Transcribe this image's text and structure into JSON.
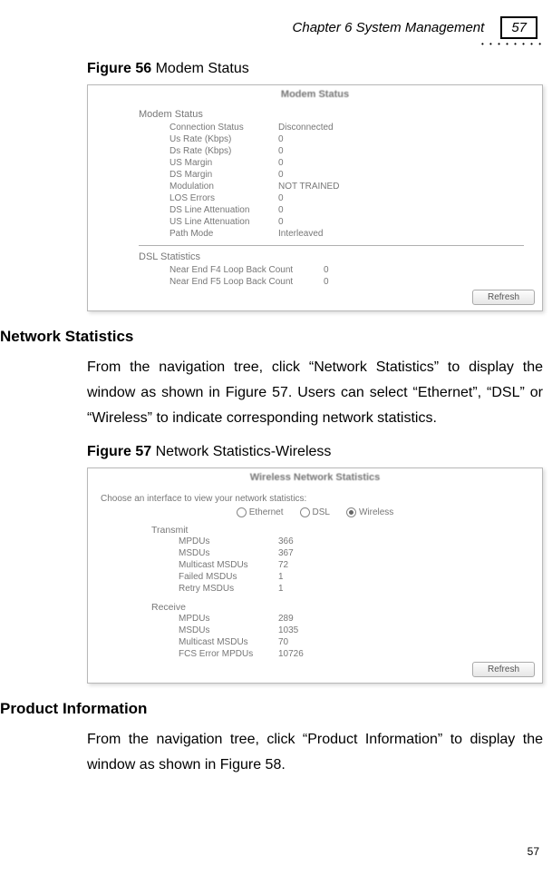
{
  "header": {
    "chapter": "Chapter 6 System Management",
    "page_box": "57"
  },
  "fig56": {
    "caption_bold": "Figure 56",
    "caption_rest": " Modem Status",
    "panel_title": "Modem Status",
    "section1": "Modem Status",
    "rows1": [
      {
        "k": "Connection Status",
        "v": "Disconnected"
      },
      {
        "k": "Us Rate (Kbps)",
        "v": "0"
      },
      {
        "k": "Ds Rate (Kbps)",
        "v": "0"
      },
      {
        "k": "US Margin",
        "v": "0"
      },
      {
        "k": "DS Margin",
        "v": "0"
      },
      {
        "k": "Modulation",
        "v": "NOT TRAINED"
      },
      {
        "k": "LOS Errors",
        "v": "0"
      },
      {
        "k": "DS Line Attenuation",
        "v": "0"
      },
      {
        "k": "US Line Attenuation",
        "v": "0"
      },
      {
        "k": "Path Mode",
        "v": "Interleaved"
      }
    ],
    "section2": "DSL Statistics",
    "rows2": [
      {
        "k": "Near End F4 Loop Back Count",
        "v": "0"
      },
      {
        "k": "Near End F5 Loop Back Count",
        "v": "0"
      }
    ],
    "refresh": "Refresh"
  },
  "network_stats": {
    "heading": "Network Statistics",
    "para": "From the navigation tree, click “Network Statistics” to display the window as shown in Figure 57. Users can select “Ethernet”, “DSL” or “Wireless” to indicate corresponding network statistics."
  },
  "fig57": {
    "caption_bold": "Figure 57",
    "caption_rest": " Network Statistics-Wireless",
    "panel_title": "Wireless Network Statistics",
    "choose": "Choose an interface to view your network statistics:",
    "radios": [
      {
        "label": "Ethernet",
        "checked": false
      },
      {
        "label": "DSL",
        "checked": false
      },
      {
        "label": "Wireless",
        "checked": true
      }
    ],
    "transmit_label": "Transmit",
    "transmit_rows": [
      {
        "k": "MPDUs",
        "v": "366"
      },
      {
        "k": "MSDUs",
        "v": "367"
      },
      {
        "k": "Multicast MSDUs",
        "v": "72"
      },
      {
        "k": "Failed MSDUs",
        "v": "1"
      },
      {
        "k": "Retry MSDUs",
        "v": "1"
      }
    ],
    "receive_label": "Receive",
    "receive_rows": [
      {
        "k": "MPDUs",
        "v": "289"
      },
      {
        "k": "MSDUs",
        "v": "1035"
      },
      {
        "k": "Multicast MSDUs",
        "v": "70"
      },
      {
        "k": "FCS Error MPDUs",
        "v": "10726"
      }
    ],
    "refresh": "Refresh"
  },
  "product_info": {
    "heading": "Product Information",
    "para": "From the navigation tree, click “Product Information” to display the window as shown in Figure 58."
  },
  "footer_page": "57"
}
